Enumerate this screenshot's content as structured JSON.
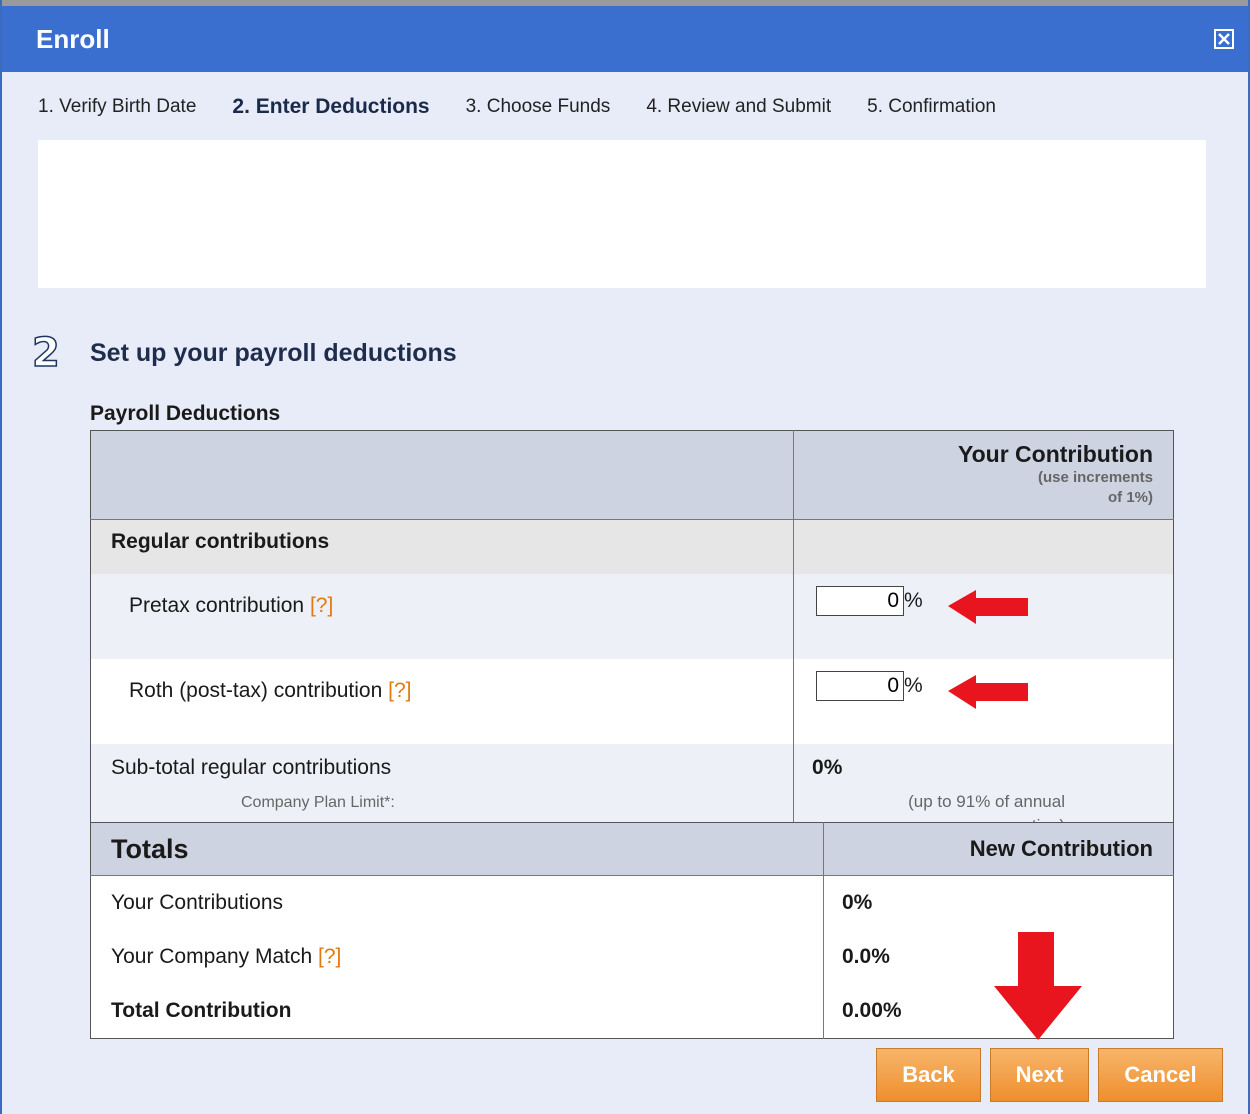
{
  "dialog": {
    "title": "Enroll",
    "close_icon": "close-icon"
  },
  "steps": [
    {
      "label": "1. Verify Birth Date",
      "active": false
    },
    {
      "label": "2. Enter Deductions",
      "active": true
    },
    {
      "label": "3. Choose Funds",
      "active": false
    },
    {
      "label": "4. Review and Submit",
      "active": false
    },
    {
      "label": "5. Confirmation",
      "active": false
    }
  ],
  "section": {
    "number": "2",
    "title": "Set up your payroll deductions"
  },
  "payroll": {
    "label": "Payroll Deductions",
    "header": {
      "title": "Your Contribution",
      "sub1": "(use increments",
      "sub2": "of 1%)"
    },
    "group_label": "Regular contributions",
    "pretax": {
      "label": "Pretax contribution",
      "help": "[?]",
      "value": "0",
      "unit": "%"
    },
    "roth": {
      "label": "Roth (post-tax) contribution",
      "help": "[?]",
      "value": "0",
      "unit": "%"
    },
    "subtotal": {
      "label": "Sub-total regular contributions",
      "value": "0%",
      "limit_label": "Company Plan Limit*:",
      "limit_note1": "(up to 91% of annual",
      "limit_note2": "compensation)"
    }
  },
  "totals": {
    "title": "Totals",
    "column": "New Contribution",
    "rows": [
      {
        "label": "Your Contributions",
        "help": "",
        "value": "0%"
      },
      {
        "label": "Your Company Match",
        "help": "[?]",
        "value": "0.0%"
      },
      {
        "label": "Total Contribution",
        "help": "",
        "value": "0.00%"
      }
    ]
  },
  "buttons": {
    "back": "Back",
    "next": "Next",
    "cancel": "Cancel"
  },
  "colors": {
    "titlebar": "#3b6fcf",
    "accent_orange": "#ee8f2e",
    "annotation_red": "#e8141e"
  }
}
